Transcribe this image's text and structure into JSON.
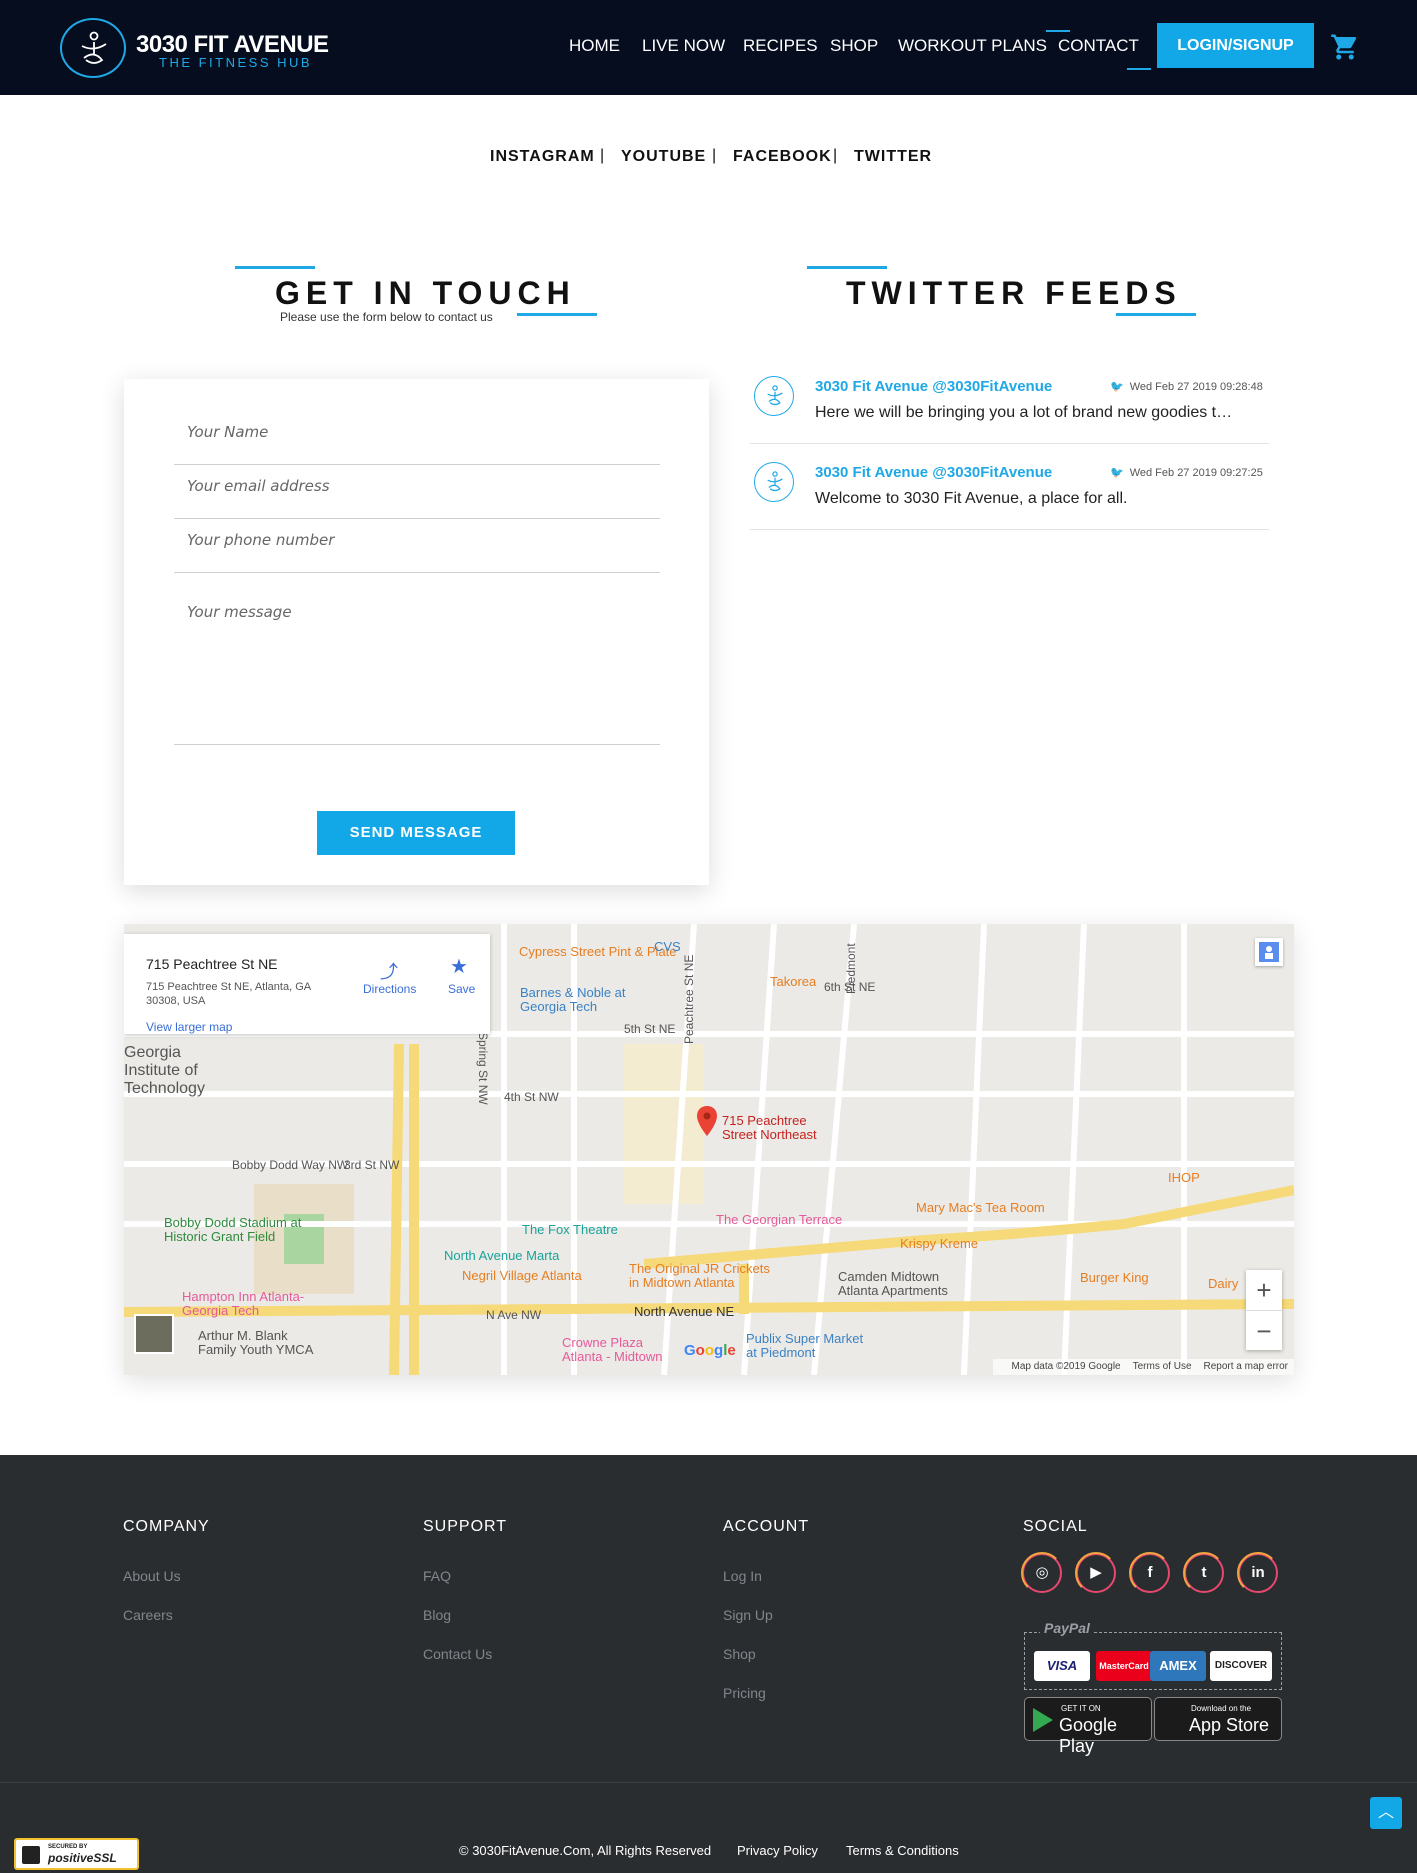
{
  "header": {
    "logo_title": "3030 FIT AVENUE",
    "logo_sub": "THE FITNESS HUB",
    "nav": [
      "HOME",
      "LIVE NOW",
      "RECIPES",
      "SHOP",
      "WORKOUT PLANS",
      "CONTACT"
    ],
    "active_nav": "CONTACT",
    "login_label": "LOGIN/SIGNUP"
  },
  "social_top": {
    "links": [
      "INSTAGRAM",
      "YOUTUBE",
      "FACEBOOK",
      "TWITTER"
    ],
    "separator": "|"
  },
  "contact": {
    "title": "GET IN TOUCH",
    "subtitle": "Please use the form below to contact us",
    "placeholders": {
      "name": "Your Name",
      "email": "Your email address",
      "phone": "Your phone number",
      "message": "Your message"
    },
    "send_label": "SEND MESSAGE"
  },
  "twitter": {
    "title": "TWITTER FEEDS",
    "tweets": [
      {
        "author": "3030 Fit Avenue @3030FitAvenue",
        "date": "Wed Feb 27 2019 09:28:48",
        "text": "Here we will be bringing you a lot of brand new goodies t…"
      },
      {
        "author": "3030 Fit Avenue @3030FitAvenue",
        "date": "Wed Feb 27 2019 09:27:25",
        "text": "Welcome to 3030 Fit Avenue, a place for all."
      }
    ]
  },
  "map": {
    "info_title": "715 Peachtree St NE",
    "info_addr": "715 Peachtree St NE, Atlanta, GA 30308, USA",
    "view_larger": "View larger map",
    "directions": "Directions",
    "save": "Save",
    "marker_label": "715 Peachtree Street Northeast",
    "streets": [
      "Cypress Street Pint & Plate",
      "CVS",
      "Takorea",
      "Barnes & Noble at Georgia Tech",
      "Georgia Institute of Technology",
      "Bobby Dodd Stadium at Historic Grant Field",
      "The Fox Theatre",
      "North Avenue Marta",
      "Negril Village Atlanta",
      "The Original JR Crickets in Midtown Atlanta",
      "The Georgian Terrace",
      "Mary Mac's Tea Room",
      "Krispy Kreme",
      "IHOP",
      "Burger King",
      "Dairy",
      "Camden Midtown Atlanta Apartments",
      "Hampton Inn Atlanta-Georgia Tech",
      "Arthur M. Blank Family Youth YMCA",
      "Crowne Plaza Atlanta - Midtown",
      "Publix Super Market at Piedmont"
    ],
    "road_labels": [
      "5th St NE",
      "6th St NE",
      "4th St NW",
      "3rd St NW",
      "N Ave NW",
      "North Avenue NE",
      "Peachtree St NE",
      "Spring St NW",
      "Piedmont",
      "Bobby Dodd Way NW"
    ],
    "footer": [
      "Map data ©2019 Google",
      "Terms of Use",
      "Report a map error"
    ],
    "google": "Google"
  },
  "footer": {
    "columns": [
      {
        "title": "COMPANY",
        "links": [
          "About Us",
          "Careers"
        ]
      },
      {
        "title": "SUPPORT",
        "links": [
          "FAQ",
          "Blog",
          "Contact Us"
        ]
      },
      {
        "title": "ACCOUNT",
        "links": [
          "Log In",
          "Sign Up",
          "Shop",
          "Pricing"
        ]
      },
      {
        "title": "SOCIAL",
        "links": []
      }
    ],
    "social_icons": [
      "instagram-icon",
      "youtube-icon",
      "facebook-icon",
      "twitter-icon",
      "linkedin-icon"
    ],
    "paypal": "PayPal",
    "cards": [
      "VISA",
      "MasterCard",
      "AMEX",
      "DISCOVER"
    ],
    "stores": [
      {
        "small": "GET IT ON",
        "big": "Google Play"
      },
      {
        "small": "Download on the",
        "big": "App Store"
      }
    ],
    "ssl_small": "SECURED BY",
    "ssl_big": "positiveSSL",
    "copyright": "© 3030FitAvenue.Com, All Rights Reserved",
    "privacy": "Privacy Policy",
    "terms": "Terms & Conditions"
  },
  "colors": {
    "accent": "#12a7e6",
    "header_bg": "#050d1e",
    "footer_bg": "#2a2d30"
  }
}
